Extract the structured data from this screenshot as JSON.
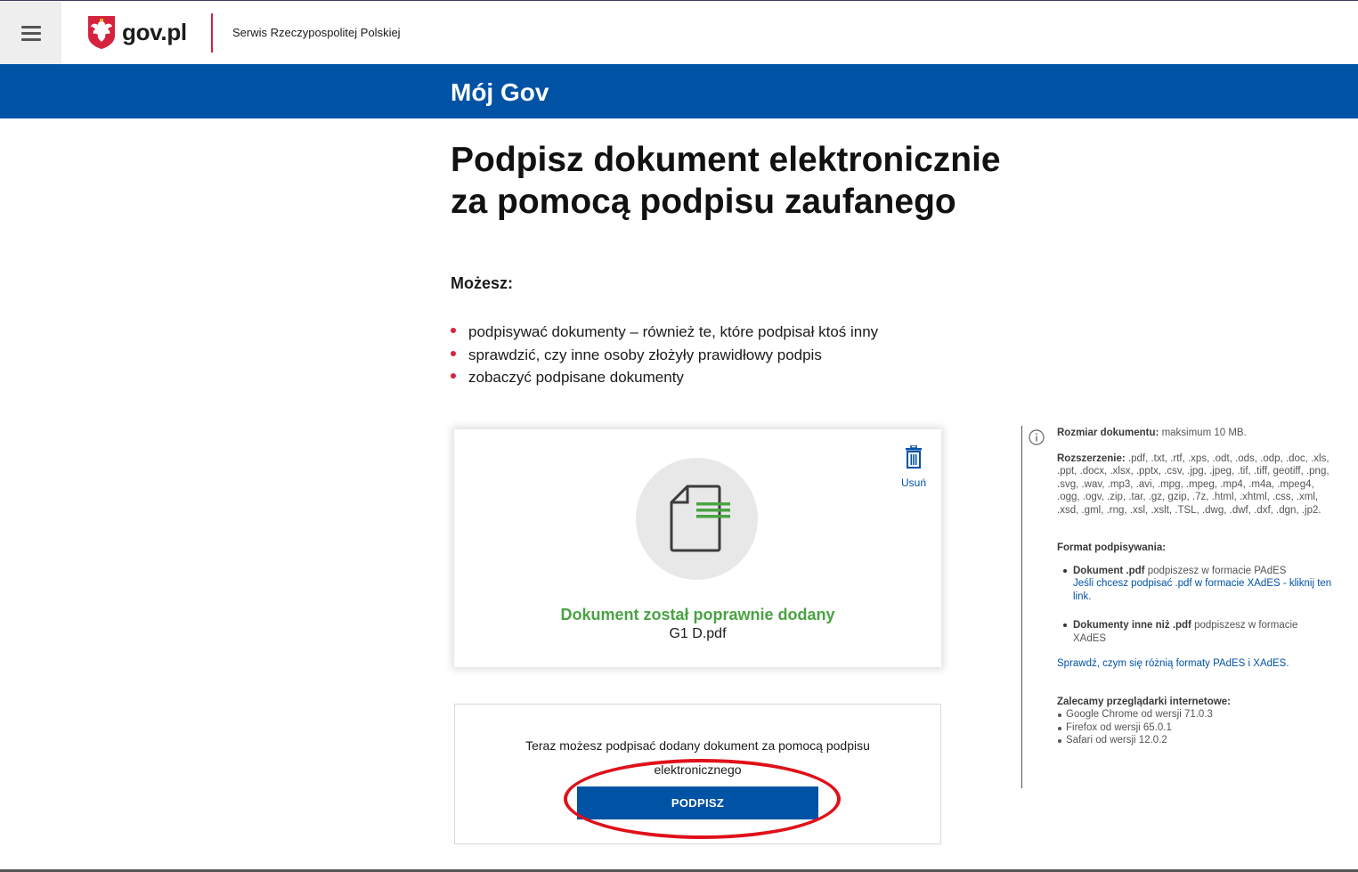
{
  "header": {
    "menu_icon": "hamburger-menu-icon",
    "logo_text": "gov.pl",
    "logo_subtitle": "Serwis Rzeczypospolitej Polskiej",
    "colors": {
      "accent_blue": "#0052a5",
      "accent_red": "#d5233f"
    }
  },
  "banner": {
    "title": "Mój Gov"
  },
  "main": {
    "title_line1": "Podpisz dokument elektronicznie",
    "title_line2": "za pomocą podpisu zaufanego",
    "can_label": "Możesz:",
    "bullets": [
      "podpisywać dokumenty – również te, które podpisał ktoś inny",
      "sprawdzić, czy inne osoby złożyły prawidłowy podpis",
      "zobaczyć podpisane dokumenty"
    ]
  },
  "upload": {
    "delete_label": "Usuń",
    "success_text": "Dokument został poprawnie dodany",
    "filename": "G1 D.pdf",
    "success_color": "#4aa343"
  },
  "sign": {
    "message": "Teraz możesz podpisać dodany dokument za pomocą podpisu elektronicznego",
    "button_label": "PODPISZ",
    "highlight_color": "#e0101a"
  },
  "info": {
    "size_label": "Rozmiar dokumentu:",
    "size_value": " maksimum 10 MB.",
    "ext_label": "Rozszerzenie:",
    "ext_value": " .pdf, .txt, .rtf, .xps, .odt, .ods, .odp, .doc, .xls, .ppt, .docx, .xlsx, .pptx, .csv, .jpg, .jpeg, .tif, .tiff, geotiff, .png, .svg, .wav, .mp3, .avi, .mpg, .mpeg, .mp4, .m4a, .mpeg4, .ogg, .ogv, .zip, .tar, .gz, gzip, .7z, .html, .xhtml, .css, .xml, .xsd, .gml, .rng, .xsl, .xslt, .TSL, .dwg, .dwf, .dxf, .dgn, .jp2.",
    "format_label": "Format podpisywania:",
    "pdf_bold": "Dokument .pdf",
    "pdf_text": " podpiszesz w formacie PAdES",
    "pdf_link": "Jeśli chcesz podpisać .pdf w formacie XAdES - kliknij ten link.",
    "other_bold": "Dokumenty inne niż .pdf",
    "other_text": " podpiszesz w formacie XAdES",
    "compare_link": "Sprawdź, czym się różnią formaty PAdES i XAdES.",
    "browsers_label": "Zalecamy przeglądarki internetowe:",
    "browsers": [
      "Google Chrome od wersji 71.0.3",
      "Firefox od wersji 65.0.1",
      "Safari od wersji 12.0.2"
    ]
  }
}
